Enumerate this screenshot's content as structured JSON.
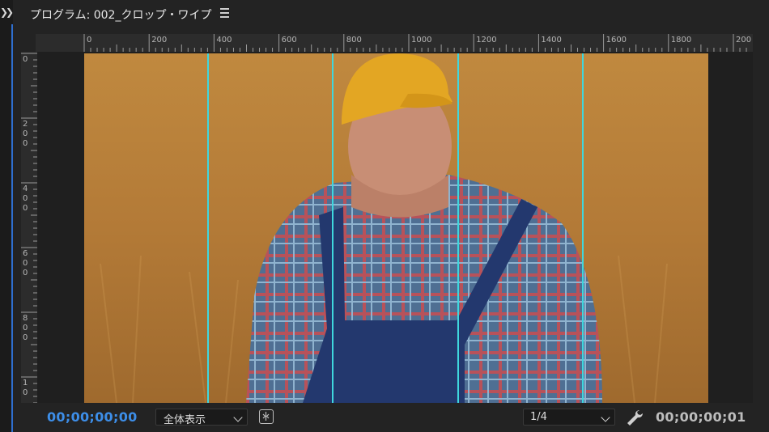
{
  "header": {
    "title": "プログラム: 002_クロップ・ワイプ",
    "menu_icon": "hamburger-menu-icon",
    "expand_icon": "double-chevron-right-icon"
  },
  "rulers": {
    "horizontal": [
      "0",
      "200",
      "400",
      "600",
      "800",
      "1000",
      "1200",
      "1400",
      "1600",
      "1800",
      "200"
    ],
    "vertical": [
      "0",
      "200",
      "400",
      "600",
      "800",
      "10"
    ]
  },
  "viewer": {
    "guide_color": "#3fd7de",
    "guide_count": 4
  },
  "footer": {
    "timecode_current": "00;00;00;00",
    "timecode_current_color": "#3d8ee8",
    "fit_select": "全体表示",
    "resolution_select": "1/4",
    "timecode_duration": "00;00;00;01",
    "settings_icon": "wrench-icon",
    "toggle_icon": "insert-edit-toggle-icon"
  }
}
